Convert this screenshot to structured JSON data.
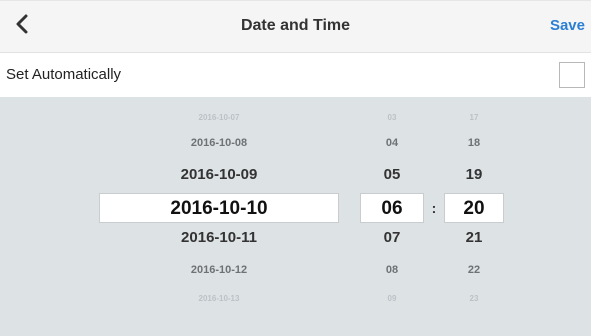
{
  "header": {
    "back_icon": "chevron-left-icon",
    "title": "Date and Time",
    "save_label": "Save",
    "save_color": "#2a7fd4"
  },
  "auto_row": {
    "label": "Set Automatically",
    "checked": false
  },
  "picker": {
    "background": "#dde2e5",
    "separator": ":",
    "date": {
      "items": [
        "2016-10-07",
        "2016-10-08",
        "2016-10-09",
        "2016-10-10",
        "2016-10-11",
        "2016-10-12",
        "2016-10-13"
      ],
      "selected": "2016-10-10"
    },
    "hour": {
      "items": [
        "03",
        "04",
        "05",
        "06",
        "07",
        "08",
        "09"
      ],
      "selected": "06"
    },
    "minute": {
      "items": [
        "17",
        "18",
        "19",
        "20",
        "21",
        "22",
        "23"
      ],
      "selected": "20"
    }
  }
}
